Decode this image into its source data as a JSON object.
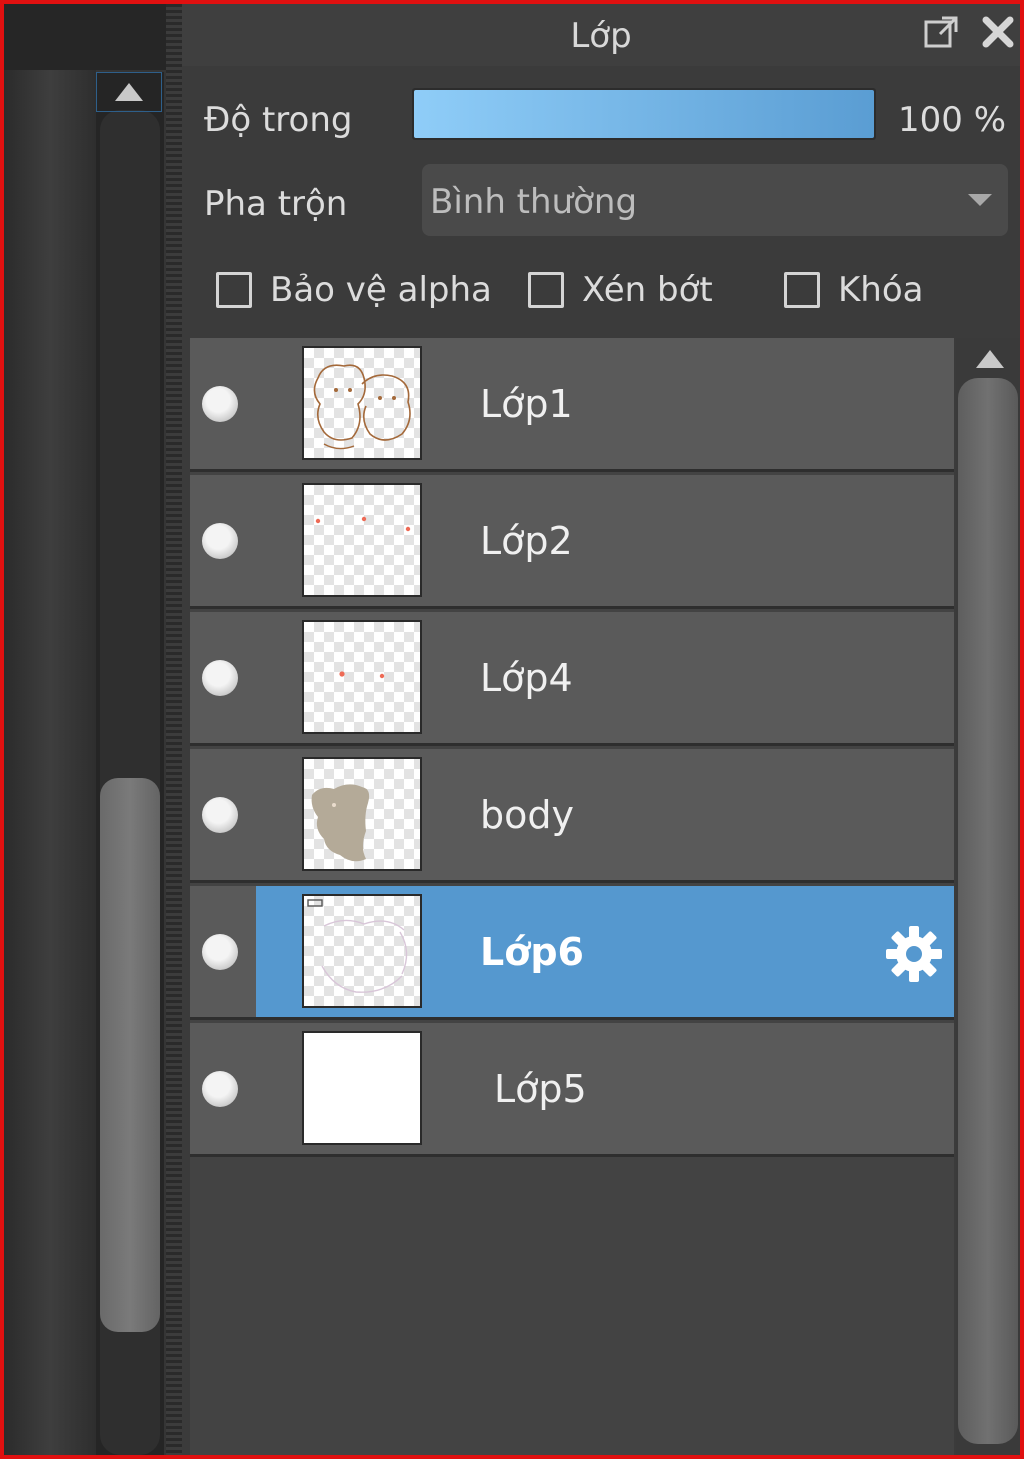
{
  "panel": {
    "title": "Lớp",
    "opacity_label": "Độ trong",
    "opacity_value": "100 %",
    "opacity_level": 1.0,
    "blend_label": "Pha trộn",
    "blend_value": "Bình thường",
    "checkboxes": [
      {
        "label": "Bảo vệ alpha",
        "checked": false
      },
      {
        "label": "Xén bớt",
        "checked": false
      },
      {
        "label": "Khóa",
        "checked": false
      }
    ]
  },
  "layers": [
    {
      "name": "Lớp1",
      "visible": true,
      "selected": false,
      "thumb": "line-art"
    },
    {
      "name": "Lớp2",
      "visible": true,
      "selected": false,
      "thumb": "red-dots"
    },
    {
      "name": "Lớp4",
      "visible": true,
      "selected": false,
      "thumb": "red-dots"
    },
    {
      "name": "body",
      "visible": true,
      "selected": false,
      "thumb": "body-shape"
    },
    {
      "name": "Lớp6",
      "visible": true,
      "selected": true,
      "thumb": "faint-lines"
    },
    {
      "name": "Lớp5",
      "visible": true,
      "selected": false,
      "thumb": "white-fill"
    }
  ],
  "icons": {
    "popout": "popout-icon",
    "close": "close-icon",
    "settings": "gear-icon"
  },
  "colors": {
    "selection": "#5598cf",
    "opacity_fill_start": "#8fcdf8",
    "opacity_fill_end": "#5a9dd3"
  }
}
